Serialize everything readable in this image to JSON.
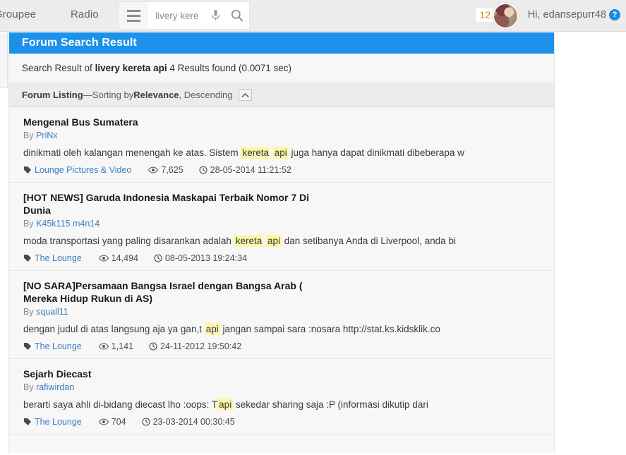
{
  "navbar": {
    "brand": "Groupee",
    "radio": "Radio",
    "menu_icon": "hamburger-icon",
    "search": {
      "value": "livery kere",
      "placeholder": "livery kere",
      "mic_icon": "microphone-icon",
      "submit_icon": "search-icon"
    },
    "alerts_count": "12",
    "greeting": "Hi, edansepurr48",
    "help_icon": "question-mark-icon",
    "accent_color": "#1b91e9",
    "badge_color": "#d48806"
  },
  "panel": {
    "title": "Forum Search Result",
    "summary_prefix": "Search Result of ",
    "summary_query": "livery kereta api",
    "summary_suffix": " 4 Results found (0.0071 sec)",
    "listing": {
      "label": "Forum Listing",
      "dash": " — ",
      "sorting_prefix": "Sorting by ",
      "sort_field": "Relevance",
      "sort_direction": ", Descending",
      "collapse_icon": "chevron-up-icon"
    }
  },
  "results": [
    {
      "title": "Mengenal Bus Sumatera",
      "by_label": "By ",
      "author": "PriNx",
      "snippet_before": "dinikmati oleh kalangan menengah ke atas. Sistem ",
      "highlight_1": "kereta",
      "snippet_mid": " ",
      "highlight_2": "api",
      "snippet_after": " juga hanya dapat dinikmati dibeberapa w",
      "forum": "Lounge Pictures & Video",
      "views": "7,625",
      "date": "28-05-2014 11:21:52",
      "tag_icon": "tag-icon",
      "views_icon": "eye-icon",
      "date_icon": "clock-icon"
    },
    {
      "title": "[HOT NEWS] Garuda Indonesia Maskapai Terbaik Nomor 7 Di Dunia",
      "by_label": "By ",
      "author": "K45k115 m4n14",
      "snippet_before": "moda transportasi yang paling disarankan adalah ",
      "highlight_1": "kereta",
      "snippet_mid": " ",
      "highlight_2": "api",
      "snippet_after": " dan setibanya Anda di Liverpool, anda bi",
      "forum": "The Lounge",
      "views": "14,494",
      "date": "08-05-2013 19:24:34",
      "tag_icon": "tag-icon",
      "views_icon": "eye-icon",
      "date_icon": "clock-icon"
    },
    {
      "title": "[NO SARA]Persamaan Bangsa Israel dengan Bangsa Arab ( Mereka Hidup Rukun di AS)",
      "by_label": "By ",
      "author": "squall11",
      "snippet_before": "dengan judul di atas langsung aja ya gan,t ",
      "highlight_1": "api",
      "snippet_mid": "",
      "highlight_2": "",
      "snippet_after": " jangan sampai sara :nosara http://stat.ks.kidsklik.co",
      "forum": "The Lounge",
      "views": "1,141",
      "date": "24-11-2012 19:50:42",
      "tag_icon": "tag-icon",
      "views_icon": "eye-icon",
      "date_icon": "clock-icon"
    },
    {
      "title": "Sejarh Diecast",
      "by_label": "By ",
      "author": "rafiwirdan",
      "snippet_before": "berarti saya ahli di-bidang diecast lho :oops: T",
      "highlight_1": "api",
      "snippet_mid": "",
      "highlight_2": "",
      "snippet_after": " sekedar sharing saja :P (informasi dikutip dari",
      "forum": "The Lounge",
      "views": "704",
      "date": "23-03-2014 00:30:45",
      "tag_icon": "tag-icon",
      "views_icon": "eye-icon",
      "date_icon": "clock-icon"
    }
  ]
}
